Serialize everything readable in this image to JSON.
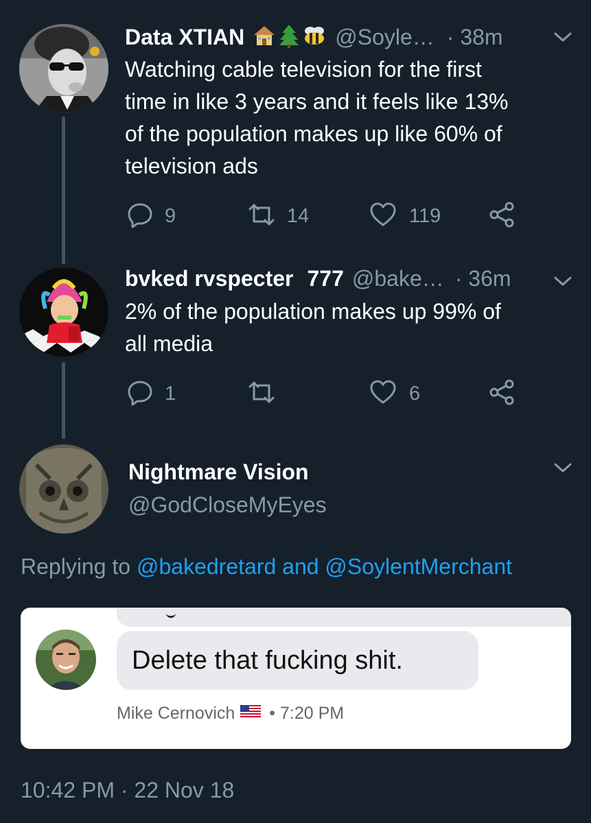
{
  "tweet1": {
    "name": "Data XTIAN",
    "emojis": [
      "house-icon",
      "evergreen-tree-icon",
      "bee-icon"
    ],
    "handle": "@Soyle…",
    "time": "· 38m",
    "text_lines": [
      "Watching cable television for the first",
      "time in like 3 years and it feels like 13%",
      "of the population makes up like 60% of",
      "television ads"
    ],
    "replies": "9",
    "retweets": "14",
    "likes": "119"
  },
  "tweet2": {
    "name": "bvked rvspecter",
    "name_emoji": "",
    "name_suffix": "777",
    "handle": "@bake…",
    "time": "· 36m",
    "text_lines": [
      "2% of the population makes up 99% of",
      "all media"
    ],
    "replies": "1",
    "retweets": "",
    "likes": "6"
  },
  "tweet3": {
    "name": "Nightmare Vision",
    "handle": "@GodCloseMyEyes",
    "replying_prefix": "Replying to",
    "replying_user1": "@bakedretard",
    "replying_and": "and",
    "replying_user2": "@SoylentMerchant",
    "embedded": {
      "message": "Delete that fucking shit.",
      "sender": "Mike Cernovich",
      "time": "• 7:20 PM"
    },
    "timestamp": "10:42 PM · 22 Nov 18"
  },
  "colors": {
    "background": "#15202b",
    "secondary_text": "#8899a6",
    "link": "#1da1f2",
    "thread_line": "#3d5466"
  }
}
